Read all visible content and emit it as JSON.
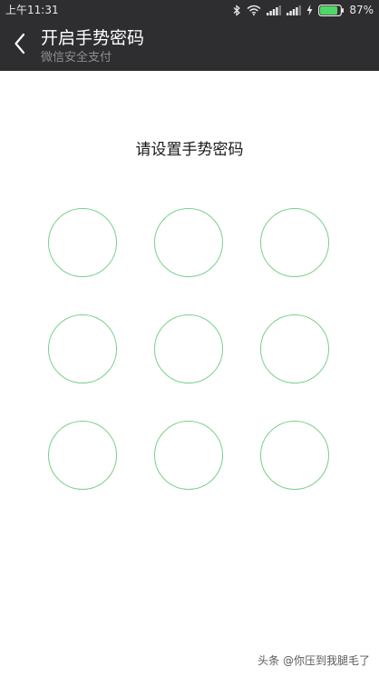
{
  "status_bar": {
    "time": "上午11:31",
    "battery_percent": "87%",
    "battery_level": 0.87,
    "icons": [
      "bluetooth-icon",
      "wifi-icon",
      "signal-icon",
      "signal-icon",
      "charging-icon",
      "battery-icon"
    ]
  },
  "header": {
    "title": "开启手势密码",
    "subtitle": "微信安全支付",
    "back_icon": "chevron-left-icon"
  },
  "main": {
    "instruction": "请设置手势密码",
    "pattern_dots": [
      1,
      2,
      3,
      4,
      5,
      6,
      7,
      8,
      9
    ],
    "dot_color": "#7ad08a"
  },
  "watermark": {
    "text": "头条 @你压到我腿毛了"
  },
  "colors": {
    "header_bg": "#2e2e30",
    "page_bg": "#ffffff",
    "accent_green": "#7ad08a"
  }
}
